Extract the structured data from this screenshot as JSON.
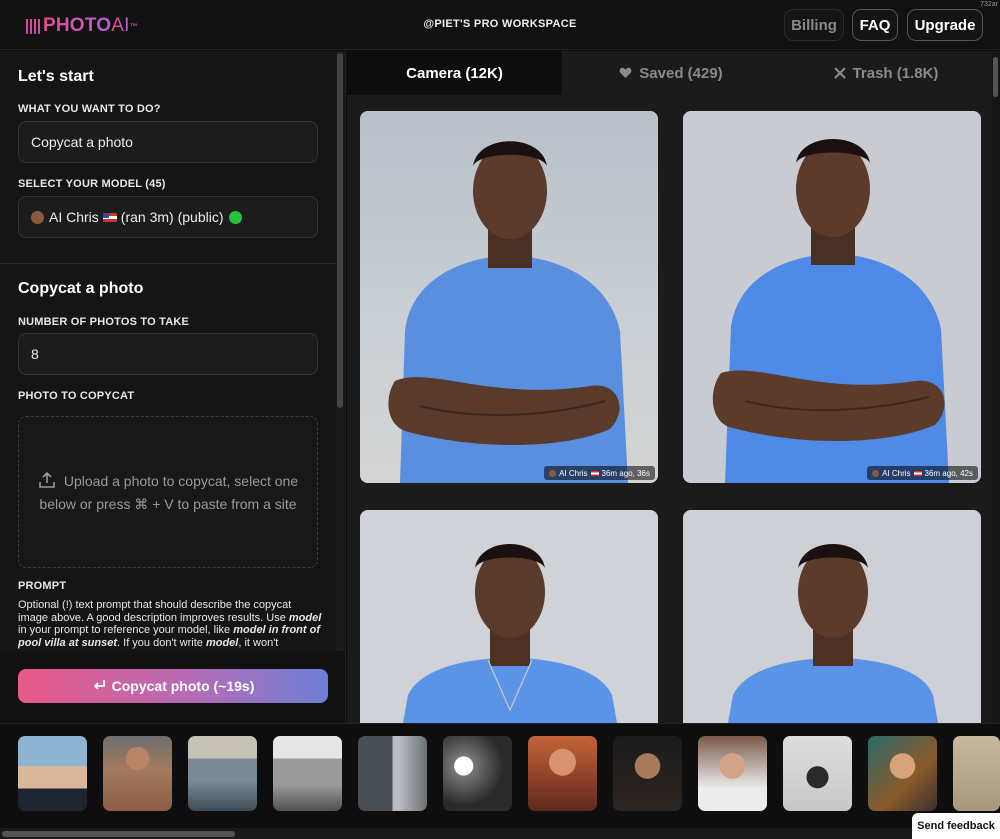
{
  "header": {
    "logo_text": "PHOTO",
    "logo_ai": " AI",
    "logo_tm": "™",
    "workspace": "@PIET'S PRO WORKSPACE",
    "billing": "Billing",
    "faq": "FAQ",
    "upgrade": "Upgrade",
    "corner_tag": "732ar"
  },
  "sidebar": {
    "start_title": "Let's start",
    "what_label": "WHAT YOU WANT TO DO?",
    "what_value": "Copycat a photo",
    "model_label": "SELECT YOUR MODEL (45)",
    "model_name": "AI Chris",
    "model_meta": "(ran 3m) (public)",
    "copycat_title": "Copycat a photo",
    "num_label": "NUMBER OF PHOTOS TO TAKE",
    "num_value": "8",
    "photo_label": "PHOTO TO COPYCAT",
    "dropzone_text": "Upload a photo to copycat, select one below or press ⌘ + V to paste from a site",
    "prompt_label": "PROMPT",
    "prompt_p1": "Optional (!) text prompt that should describe the copycat image above. A good description improves results. Use ",
    "prompt_b1": "model",
    "prompt_p2": " in your prompt to reference your model, like ",
    "prompt_b2": "model in front of pool villa at sunset",
    "prompt_p3": ". If you don't write ",
    "prompt_b3": "model",
    "prompt_p4": ", it won't",
    "cta_label": "Copycat photo (~19s)"
  },
  "tabs": [
    {
      "label": "Camera (12K)",
      "icon": "camera-icon",
      "active": true
    },
    {
      "label": "Saved (429)",
      "icon": "heart-icon",
      "active": false
    },
    {
      "label": "Trash (1.8K)",
      "icon": "x-icon",
      "active": false
    }
  ],
  "photos": [
    {
      "model": "AI Chris",
      "meta": "36m ago, 36s"
    },
    {
      "model": "AI Chris",
      "meta": "36m ago, 42s"
    },
    {
      "model": "",
      "meta": ""
    },
    {
      "model": "",
      "meta": ""
    }
  ],
  "footer": {
    "feedback": "Send feedback"
  },
  "colors": {
    "accent_pink": "#e95a86",
    "accent_blue": "#6c7fd6",
    "shirt_blue": "#5a8fe0",
    "status_green": "#25c23a"
  }
}
